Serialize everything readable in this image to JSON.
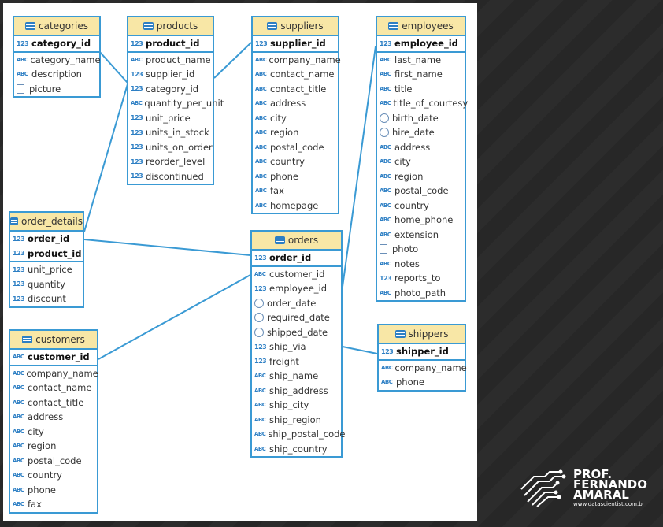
{
  "tables": [
    {
      "id": "categories",
      "title": "categories",
      "pk": [
        {
          "t": "123",
          "n": "category_id"
        }
      ],
      "cols": [
        {
          "t": "abc",
          "n": "category_name"
        },
        {
          "t": "abc",
          "n": "description"
        },
        {
          "t": "img",
          "n": "picture"
        }
      ]
    },
    {
      "id": "products",
      "title": "products",
      "pk": [
        {
          "t": "123",
          "n": "product_id"
        }
      ],
      "cols": [
        {
          "t": "abc",
          "n": "product_name"
        },
        {
          "t": "123",
          "n": "supplier_id"
        },
        {
          "t": "123",
          "n": "category_id"
        },
        {
          "t": "abc",
          "n": "quantity_per_unit"
        },
        {
          "t": "123",
          "n": "unit_price"
        },
        {
          "t": "123",
          "n": "units_in_stock"
        },
        {
          "t": "123",
          "n": "units_on_order"
        },
        {
          "t": "123",
          "n": "reorder_level"
        },
        {
          "t": "123",
          "n": "discontinued"
        }
      ]
    },
    {
      "id": "suppliers",
      "title": "suppliers",
      "pk": [
        {
          "t": "123",
          "n": "supplier_id"
        }
      ],
      "cols": [
        {
          "t": "abc",
          "n": "company_name"
        },
        {
          "t": "abc",
          "n": "contact_name"
        },
        {
          "t": "abc",
          "n": "contact_title"
        },
        {
          "t": "abc",
          "n": "address"
        },
        {
          "t": "abc",
          "n": "city"
        },
        {
          "t": "abc",
          "n": "region"
        },
        {
          "t": "abc",
          "n": "postal_code"
        },
        {
          "t": "abc",
          "n": "country"
        },
        {
          "t": "abc",
          "n": "phone"
        },
        {
          "t": "abc",
          "n": "fax"
        },
        {
          "t": "abc",
          "n": "homepage"
        }
      ]
    },
    {
      "id": "employees",
      "title": "employees",
      "pk": [
        {
          "t": "123",
          "n": "employee_id"
        }
      ],
      "cols": [
        {
          "t": "abc",
          "n": "last_name"
        },
        {
          "t": "abc",
          "n": "first_name"
        },
        {
          "t": "abc",
          "n": "title"
        },
        {
          "t": "abc",
          "n": "title_of_courtesy"
        },
        {
          "t": "clk",
          "n": "birth_date"
        },
        {
          "t": "clk",
          "n": "hire_date"
        },
        {
          "t": "abc",
          "n": "address"
        },
        {
          "t": "abc",
          "n": "city"
        },
        {
          "t": "abc",
          "n": "region"
        },
        {
          "t": "abc",
          "n": "postal_code"
        },
        {
          "t": "abc",
          "n": "country"
        },
        {
          "t": "abc",
          "n": "home_phone"
        },
        {
          "t": "abc",
          "n": "extension"
        },
        {
          "t": "img",
          "n": "photo"
        },
        {
          "t": "abc",
          "n": "notes"
        },
        {
          "t": "123",
          "n": "reports_to"
        },
        {
          "t": "abc",
          "n": "photo_path"
        }
      ]
    },
    {
      "id": "order_details",
      "title": "order_details",
      "pk": [
        {
          "t": "123",
          "n": "order_id"
        },
        {
          "t": "123",
          "n": "product_id"
        }
      ],
      "cols": [
        {
          "t": "123",
          "n": "unit_price"
        },
        {
          "t": "123",
          "n": "quantity"
        },
        {
          "t": "123",
          "n": "discount"
        }
      ]
    },
    {
      "id": "orders",
      "title": "orders",
      "pk": [
        {
          "t": "123",
          "n": "order_id"
        }
      ],
      "cols": [
        {
          "t": "abc",
          "n": "customer_id"
        },
        {
          "t": "123",
          "n": "employee_id"
        },
        {
          "t": "clk",
          "n": "order_date"
        },
        {
          "t": "clk",
          "n": "required_date"
        },
        {
          "t": "clk",
          "n": "shipped_date"
        },
        {
          "t": "123",
          "n": "ship_via"
        },
        {
          "t": "123",
          "n": "freight"
        },
        {
          "t": "abc",
          "n": "ship_name"
        },
        {
          "t": "abc",
          "n": "ship_address"
        },
        {
          "t": "abc",
          "n": "ship_city"
        },
        {
          "t": "abc",
          "n": "ship_region"
        },
        {
          "t": "abc",
          "n": "ship_postal_code"
        },
        {
          "t": "abc",
          "n": "ship_country"
        }
      ]
    },
    {
      "id": "customers",
      "title": "customers",
      "pk": [
        {
          "t": "abc",
          "n": "customer_id"
        }
      ],
      "cols": [
        {
          "t": "abc",
          "n": "company_name"
        },
        {
          "t": "abc",
          "n": "contact_name"
        },
        {
          "t": "abc",
          "n": "contact_title"
        },
        {
          "t": "abc",
          "n": "address"
        },
        {
          "t": "abc",
          "n": "city"
        },
        {
          "t": "abc",
          "n": "region"
        },
        {
          "t": "abc",
          "n": "postal_code"
        },
        {
          "t": "abc",
          "n": "country"
        },
        {
          "t": "abc",
          "n": "phone"
        },
        {
          "t": "abc",
          "n": "fax"
        }
      ]
    },
    {
      "id": "shippers",
      "title": "shippers",
      "pk": [
        {
          "t": "123",
          "n": "shipper_id"
        }
      ],
      "cols": [
        {
          "t": "abc",
          "n": "company_name"
        },
        {
          "t": "abc",
          "n": "phone"
        }
      ]
    }
  ],
  "relationships": [
    {
      "from": "products",
      "to": "categories"
    },
    {
      "from": "products",
      "to": "suppliers"
    },
    {
      "from": "order_details",
      "to": "products"
    },
    {
      "from": "order_details",
      "to": "orders"
    },
    {
      "from": "orders",
      "to": "customers"
    },
    {
      "from": "orders",
      "to": "employees"
    },
    {
      "from": "orders",
      "to": "shippers"
    }
  ],
  "type_labels": {
    "abc": "ABC",
    "num": "123"
  },
  "logo": {
    "line1": "PROF.",
    "line2": "FERNANDO",
    "line3": "AMARAL",
    "url": "www.datascientist.com.br"
  },
  "colors": {
    "border": "#3a9ad4",
    "header": "#f8e7a6",
    "icon": "#2d7fc4"
  }
}
